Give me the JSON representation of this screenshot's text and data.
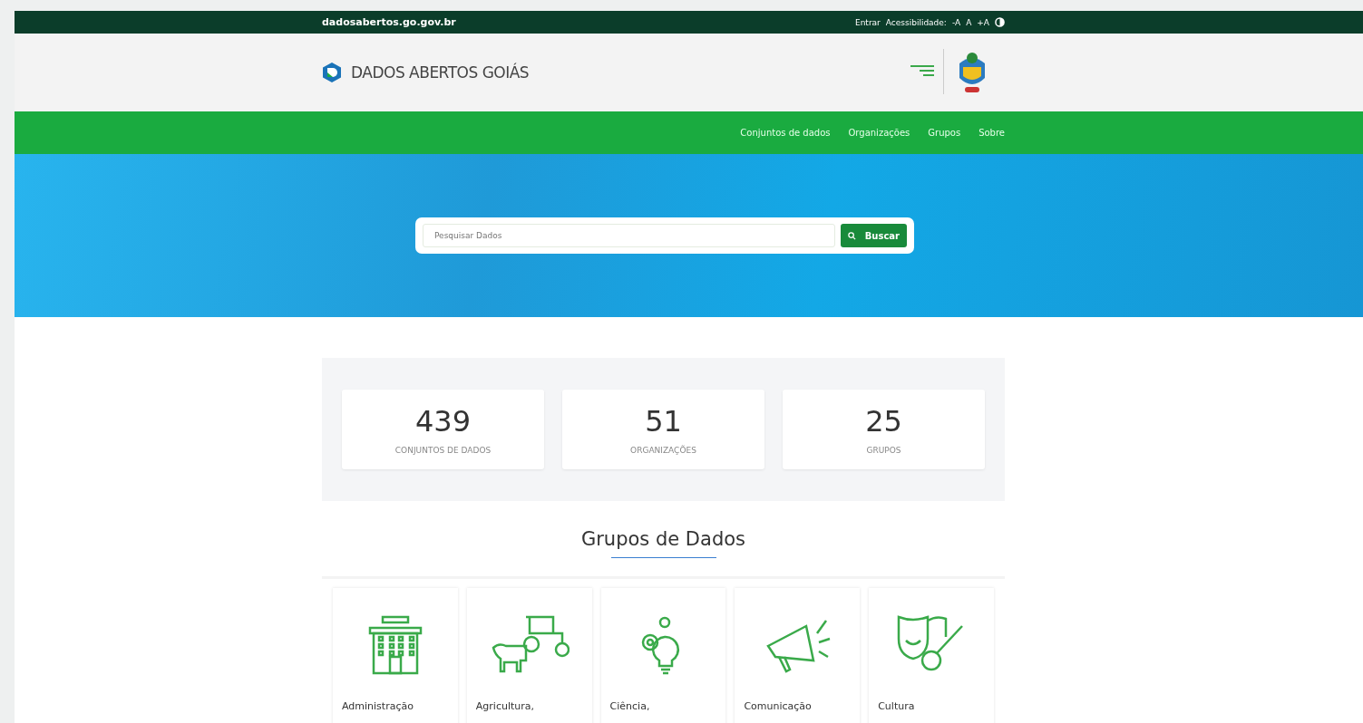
{
  "top_bar": {
    "site": "dadosabertos.go.gov.br",
    "login": "Entrar",
    "accessibility_label": "Acessibilidade:",
    "font_controls": [
      "-A",
      "A",
      "+A"
    ]
  },
  "header": {
    "title": "DADOS ABERTOS GOIÁS"
  },
  "nav": [
    {
      "label": "Conjuntos de dados"
    },
    {
      "label": "Organizações"
    },
    {
      "label": "Grupos"
    },
    {
      "label": "Sobre"
    }
  ],
  "search": {
    "placeholder": "Pesquisar Dados",
    "button": "Buscar"
  },
  "stats": [
    {
      "value": "439",
      "label": "CONJUNTOS DE DADOS"
    },
    {
      "value": "51",
      "label": "ORGANIZAÇÕES"
    },
    {
      "value": "25",
      "label": "GRUPOS"
    }
  ],
  "groups_title": "Grupos de Dados",
  "groups": [
    {
      "kind": "building",
      "name": "Administração"
    },
    {
      "kind": "farm",
      "name": "Agricultura,"
    },
    {
      "kind": "science",
      "name": "Ciência,"
    },
    {
      "kind": "megaphone",
      "name": "Comunicação"
    },
    {
      "kind": "culture",
      "name": "Cultura"
    }
  ]
}
